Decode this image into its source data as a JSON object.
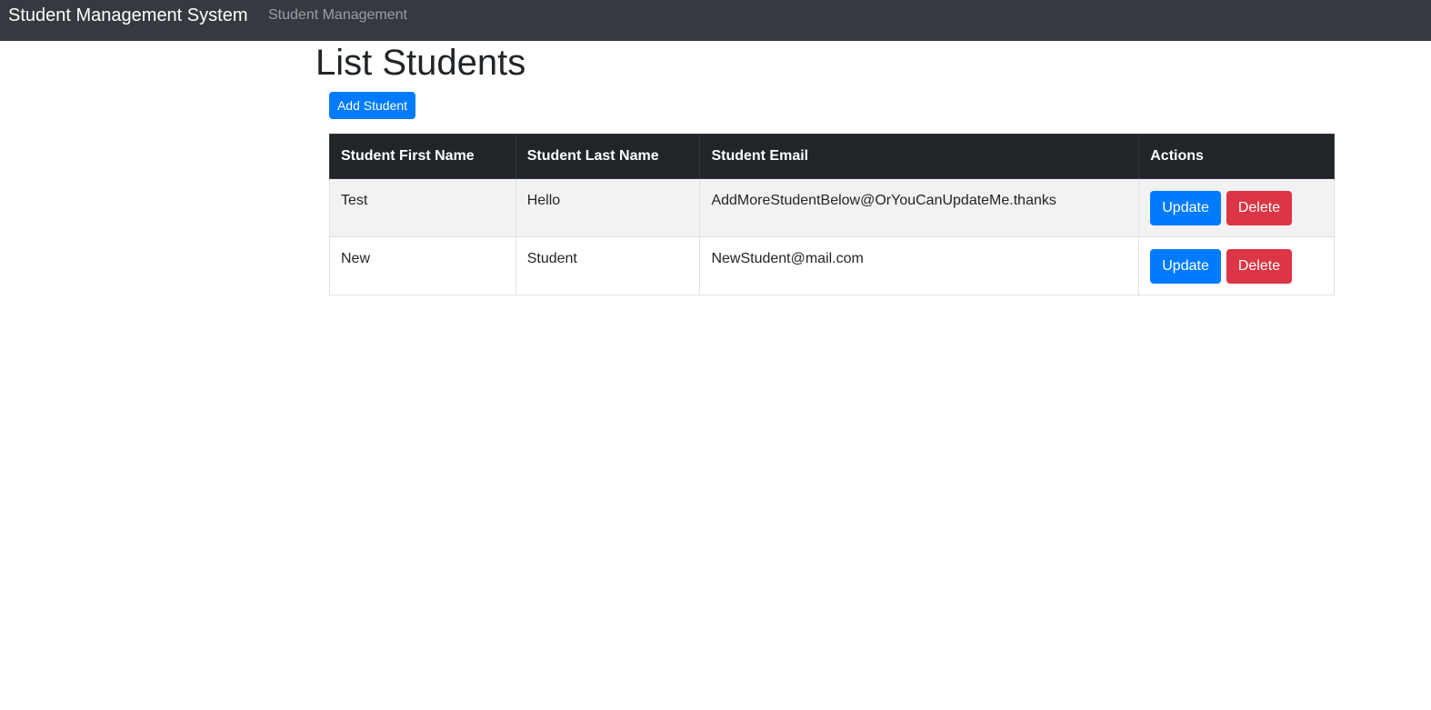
{
  "navbar": {
    "brand": "Student Management System",
    "link": "Student Management"
  },
  "page": {
    "title": "List Students",
    "add_button": "Add Student"
  },
  "table": {
    "headers": [
      "Student First Name",
      "Student Last Name",
      "Student Email",
      "Actions"
    ],
    "rows": [
      {
        "first_name": "Test",
        "last_name": "Hello",
        "email": "AddMoreStudentBelow@OrYouCanUpdateMe.thanks",
        "update_label": "Update",
        "delete_label": "Delete"
      },
      {
        "first_name": "New",
        "last_name": "Student",
        "email": "NewStudent@mail.com",
        "update_label": "Update",
        "delete_label": "Delete"
      }
    ]
  },
  "colors": {
    "navbar_bg": "#343a40",
    "table_header_bg": "#212529",
    "primary": "#007bff",
    "danger": "#dc3545",
    "striped_row": "#f2f2f2"
  }
}
